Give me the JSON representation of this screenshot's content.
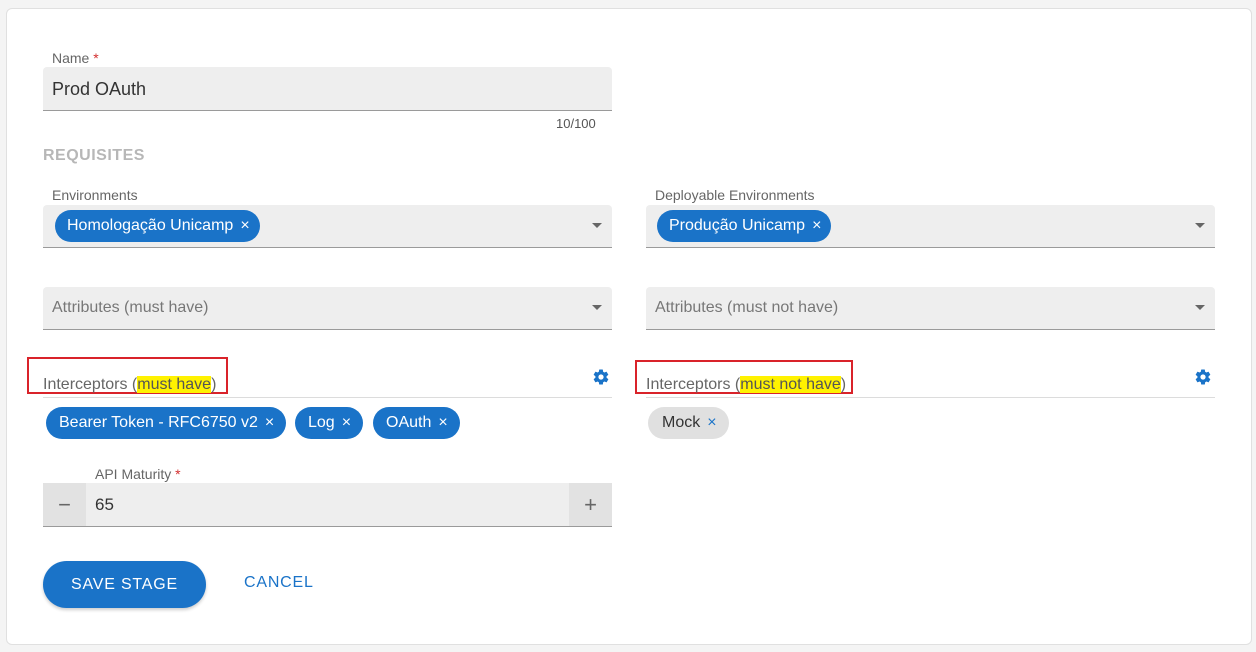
{
  "name": {
    "label": "Name",
    "required": "*",
    "value": "Prod OAuth",
    "counter": "10/100"
  },
  "section_title": "REQUISITES",
  "environments": {
    "label": "Environments",
    "chips": [
      "Homologação Unicamp"
    ]
  },
  "deployable_environments": {
    "label": "Deployable Environments",
    "chips": [
      "Produção Unicamp"
    ]
  },
  "attributes_must_have": {
    "placeholder": "Attributes (must have)"
  },
  "attributes_must_not_have": {
    "placeholder": "Attributes (must not have)"
  },
  "interceptors_must_have": {
    "prefix": "Interceptors (",
    "highlight": "must have",
    "suffix": ")",
    "chips": [
      "Bearer Token - RFC6750 v2",
      "Log",
      "OAuth"
    ]
  },
  "interceptors_must_not_have": {
    "prefix": "Interceptors (",
    "highlight": "must not have",
    "suffix": ")",
    "chips": [
      "Mock"
    ]
  },
  "api_maturity": {
    "label": "API Maturity",
    "required": "*",
    "value": "65",
    "decrement": "−",
    "increment": "+"
  },
  "actions": {
    "save": "SAVE STAGE",
    "cancel": "CANCEL"
  },
  "icons": {
    "close": "×",
    "gear": "gear-icon",
    "dropdown": "triangle-down"
  },
  "colors": {
    "primary": "#1a73c8",
    "highlight": "#fff200",
    "annotation": "#d9232a"
  }
}
